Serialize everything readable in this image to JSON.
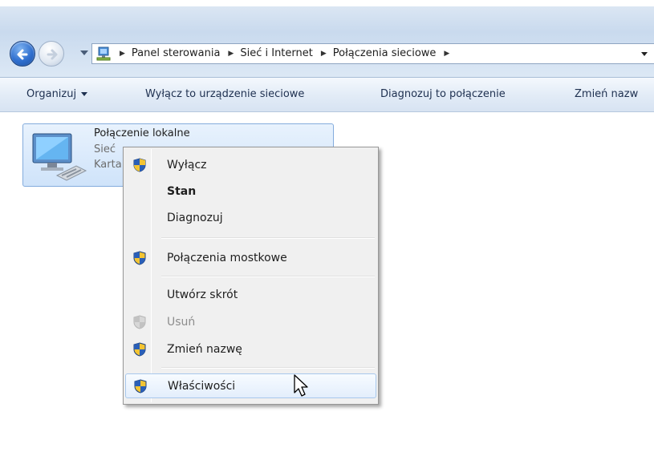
{
  "addressbar": {
    "breadcrumbs": [
      "Panel sterowania",
      "Sieć i Internet",
      "Połączenia sieciowe"
    ]
  },
  "toolbar": {
    "organize_label": "Organizuj",
    "disable_label": "Wyłącz to urządzenie sieciowe",
    "diagnose_label": "Diagnozuj to połączenie",
    "rename_label": "Zmień nazw"
  },
  "connection": {
    "name": "Połączenie lokalne",
    "line2": "Sieć",
    "line3": "Karta"
  },
  "context_menu": {
    "disable": "Wyłącz",
    "status": "Stan",
    "diagnose": "Diagnozuj",
    "bridge": "Połączenia mostkowe",
    "shortcut": "Utwórz skrót",
    "delete": "Usuń",
    "rename": "Zmień nazwę",
    "properties": "Właściwości"
  },
  "colors": {
    "tile_fill": "#cfe3fa",
    "tile_border": "#84acdd",
    "menu_background": "#f0f0f0",
    "hover_border": "#a8c8ec"
  },
  "icons": {
    "back": "back-arrow-icon",
    "forward": "forward-arrow-icon",
    "network_folder": "network-connections-icon",
    "connection": "network-adapter-icon",
    "shield": "uac-shield-icon",
    "cursor": "mouse-pointer-icon"
  }
}
